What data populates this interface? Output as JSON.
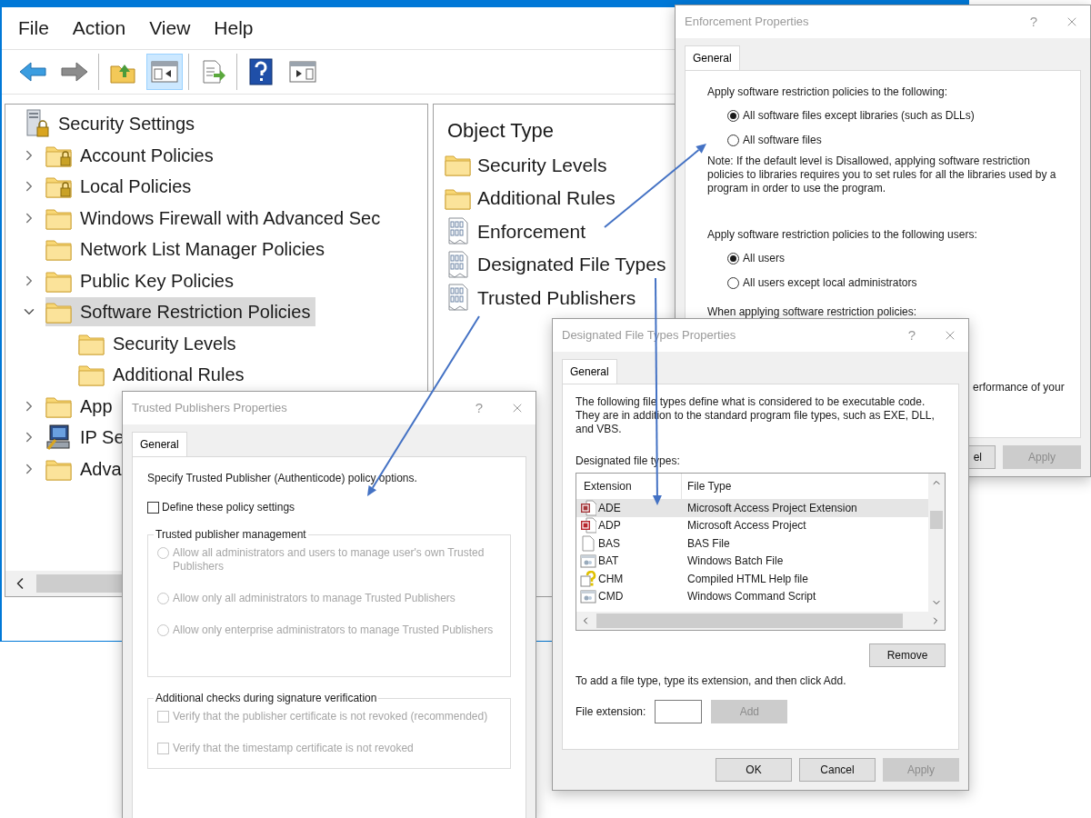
{
  "main_window": {
    "menu": [
      "File",
      "Action",
      "View",
      "Help"
    ],
    "toolbar_groups": [
      [
        {
          "kind": "back",
          "pressed": false
        },
        {
          "kind": "forward",
          "pressed": false
        }
      ],
      [
        {
          "kind": "folder-up",
          "pressed": false
        },
        {
          "kind": "console-tree",
          "pressed": true
        }
      ],
      [
        {
          "kind": "export",
          "pressed": false
        }
      ],
      [
        {
          "kind": "help",
          "pressed": false
        },
        {
          "kind": "action-pane",
          "pressed": false
        }
      ]
    ],
    "tree": {
      "label": "Security Settings",
      "kind": "server-lock",
      "children": [
        {
          "label": "Account Policies",
          "kind": "folder-lock",
          "expandable": true,
          "expanded": false,
          "selected": false
        },
        {
          "label": "Local Policies",
          "kind": "folder-lock",
          "expandable": true,
          "expanded": false,
          "selected": false
        },
        {
          "label": "Windows Firewall with Advanced Sec",
          "kind": "folder",
          "expandable": true,
          "expanded": false,
          "selected": false
        },
        {
          "label": "Network List Manager Policies",
          "kind": "folder",
          "expandable": false,
          "selected": false
        },
        {
          "label": "Public Key Policies",
          "kind": "folder",
          "expandable": true,
          "expanded": false,
          "selected": false
        },
        {
          "label": "Software Restriction Policies",
          "kind": "folder",
          "expandable": true,
          "expanded": true,
          "selected": true,
          "children": [
            {
              "label": "Security Levels",
              "kind": "folder",
              "expandable": false,
              "selected": false
            },
            {
              "label": "Additional Rules",
              "kind": "folder",
              "expandable": false,
              "selected": false
            }
          ]
        },
        {
          "label": "App",
          "kind": "folder",
          "expandable": true,
          "expanded": false,
          "selected": false
        },
        {
          "label": "IP Se",
          "kind": "computer",
          "expandable": true,
          "expanded": false,
          "selected": false
        },
        {
          "label": "Adva",
          "kind": "folder",
          "expandable": true,
          "expanded": false,
          "selected": false
        }
      ]
    },
    "details": {
      "heading": "Object Type",
      "items": [
        {
          "label": "Security Levels",
          "kind": "folder"
        },
        {
          "label": "Additional Rules",
          "kind": "folder"
        },
        {
          "label": "Enforcement",
          "kind": "policy"
        },
        {
          "label": "Designated File Types",
          "kind": "policy"
        },
        {
          "label": "Trusted Publishers",
          "kind": "policy"
        }
      ]
    }
  },
  "enforcement_dialog": {
    "title": "Enforcement Properties",
    "help": "?",
    "tab": {
      "label": "General",
      "selected": true
    },
    "sections": [
      {
        "label": "Apply software restriction policies to the following:",
        "options": [
          {
            "label": "All software files except libraries (such as DLLs)",
            "selected": true
          },
          {
            "label": "All software files",
            "selected": false
          }
        ],
        "note": "Note:  If the default level is Disallowed, applying software restriction policies to libraries requires you to set rules for all the libraries used by a program in order to use the program."
      },
      {
        "label": "Apply software restriction policies to the following users:",
        "options": [
          {
            "label": "All users",
            "selected": true
          },
          {
            "label": "All users except local administrators",
            "selected": false
          }
        ]
      },
      {
        "label": "When applying software restriction policies:"
      }
    ],
    "fragment": "erformance of your",
    "buttons": [
      {
        "label": "el",
        "disabled": false
      },
      {
        "label": "Apply",
        "disabled": true
      }
    ]
  },
  "designated_file_types_dialog": {
    "title": "Designated File Types Properties",
    "help": "?",
    "tab": {
      "label": "General",
      "selected": true
    },
    "description": "The following file types define what is considered to be executable code. They are in addition to the standard program file types, such as EXE, DLL, and VBS.",
    "list_label": "Designated file types:",
    "columns": [
      "Extension",
      "File Type"
    ],
    "rows": [
      {
        "extension": "ADE",
        "file_type": "Microsoft Access Project Extension",
        "kind": "access-extension",
        "selected": true
      },
      {
        "extension": "ADP",
        "file_type": "Microsoft Access Project",
        "kind": "access",
        "selected": false
      },
      {
        "extension": "BAS",
        "file_type": "BAS File",
        "kind": "blank",
        "selected": false
      },
      {
        "extension": "BAT",
        "file_type": "Windows Batch File",
        "kind": "script",
        "selected": false
      },
      {
        "extension": "CHM",
        "file_type": "Compiled HTML Help file",
        "kind": "help",
        "selected": false
      },
      {
        "extension": "CMD",
        "file_type": "Windows Command Script",
        "kind": "script",
        "selected": false
      }
    ],
    "remove_button": {
      "label": "Remove",
      "disabled": false
    },
    "add_hint": "To add a file type, type its extension, and then click Add.",
    "extension_label": "File extension:",
    "add_button": {
      "label": "Add",
      "disabled": true
    },
    "buttons": [
      {
        "label": "OK",
        "disabled": false
      },
      {
        "label": "Cancel",
        "disabled": false
      },
      {
        "label": "Apply",
        "disabled": true
      }
    ]
  },
  "trusted_publishers_dialog": {
    "title": "Trusted Publishers Properties",
    "help": "?",
    "tab": {
      "label": "General",
      "selected": true
    },
    "description": "Specify Trusted Publisher (Authenticode) policy options.",
    "define_checkbox": {
      "label": "Define these policy settings",
      "checked": false
    },
    "groups": [
      {
        "title": "Trusted publisher management",
        "items": [
          {
            "kind": "radio",
            "label": "Allow all administrators and users to manage user's own Trusted Publishers",
            "selected": false,
            "disabled": true
          },
          {
            "kind": "radio",
            "label": "Allow only all administrators to manage Trusted Publishers",
            "selected": false,
            "disabled": true
          },
          {
            "kind": "radio",
            "label": "Allow only enterprise administrators to manage Trusted Publishers",
            "selected": false,
            "disabled": true
          }
        ]
      },
      {
        "title": "Additional checks during signature verification",
        "items": [
          {
            "kind": "checkbox",
            "label": "Verify that the publisher certificate is not revoked (recommended)",
            "checked": false,
            "disabled": true
          },
          {
            "kind": "checkbox",
            "label": "Verify that the timestamp certificate is not revoked",
            "checked": false,
            "disabled": true
          }
        ]
      }
    ]
  }
}
